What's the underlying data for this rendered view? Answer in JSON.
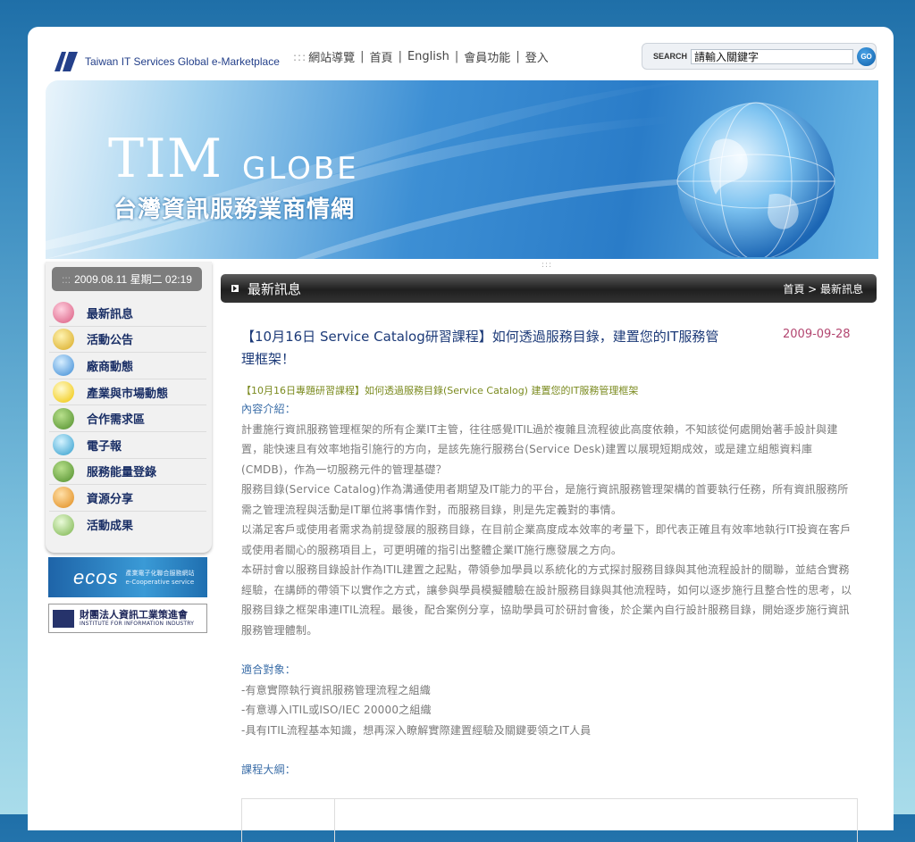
{
  "header": {
    "logo_text": "Taiwan IT Services Global e-Marketplace",
    "nav_lead": ":::",
    "nav": [
      "網站導覽",
      "首頁",
      "English",
      "會員功能",
      "登入"
    ],
    "search_label": "SEARCH",
    "search_placeholder": "請輸入關鍵字",
    "search_button": "GO"
  },
  "banner": {
    "title_main": "TIM",
    "title_globe": "GLOBE",
    "subtitle": "台灣資訊服務業商情網"
  },
  "sidebar": {
    "date_dots": ":::",
    "datetime": "2009.08.11 星期二 02:19",
    "menu": [
      {
        "label": "最新訊息",
        "icon": "pencil-icon"
      },
      {
        "label": "活動公告",
        "icon": "announcement-icon"
      },
      {
        "label": "廠商動態",
        "icon": "company-icon"
      },
      {
        "label": "產業與市場動態",
        "icon": "lightbulb-icon"
      },
      {
        "label": "合作需求區",
        "icon": "board-icon"
      },
      {
        "label": "電子報",
        "icon": "newsletter-icon"
      },
      {
        "label": "服務能量登錄",
        "icon": "register-icon"
      },
      {
        "label": "資源分享",
        "icon": "share-icon"
      },
      {
        "label": "活動成果",
        "icon": "magnifier-icon"
      }
    ],
    "ecos_big": "ecos",
    "ecos_small_cn": "產業電子化聯合服務網站",
    "ecos_small_en": "e-Cooperative service",
    "iii_cn": "財團法人資訊工業策進會",
    "iii_en": "INSTITUTE FOR INFORMATION INDUSTRY"
  },
  "main": {
    "section_title": "最新訊息",
    "breadcrumb": "首頁 > 最新訊息",
    "headline": "【10月16日 Service Catalog研習課程】如何透過服務目錄，建置您的IT服務管理框架！",
    "date": "2009-09-28",
    "subhead": "【10月16日專題研習課程】如何透過服務目錄(Service Catalog)  建置您的IT服務管理框架",
    "intro_label": "內容介紹：",
    "paragraphs": [
      "計畫施行資訊服務管理框架的所有企業IT主管，往往感覺ITIL過於複雜且流程彼此高度依賴，不知該從何處開始著手設計與建置，能快速且有效率地指引施行的方向，是該先施行服務台(Service Desk)建置以展現短期成效，或是建立組態資料庫(CMDB)，作為一切服務元件的管理基礎？",
      "服務目錄(Service Catalog)作為溝通使用者期望及IT能力的平台，是施行資訊服務管理架構的首要執行任務，所有資訊服務所需之管理流程與活動是IT單位將事情作對，而服務目錄，則是先定義對的事情。",
      "以滿足客戶或使用者需求為前提發展的服務目錄，在目前企業高度成本效率的考量下，即代表正確且有效率地執行IT投資在客戶或使用者關心的服務項目上，可更明確的指引出整體企業IT施行應發展之方向。",
      "本研討會以服務目錄設計作為ITIL建置之起點，帶領參加學員以系統化的方式探討服務目錄與其他流程設計的關聯，並結合實務經驗，在講師的帶領下以實作之方式，讓參與學員模擬體驗在設計服務目錄與其他流程時，如何以逐步施行且整合性的思考，以服務目錄之框架串連ITIL流程。最後，配合案例分享，協助學員可於研討會後，於企業內自行設計服務目錄，開始逐步施行資訊服務管理體制。"
    ],
    "audience_label": "適合對象：",
    "audience": [
      "-有意實際執行資訊服務管理流程之組織",
      "-有意導入ITIL或ISO/IEC 20000之組織",
      "-具有ITIL流程基本知識，想再深入瞭解實際建置經驗及關鍵要領之IT人員"
    ],
    "outline_label": "課程大綱："
  },
  "colors": {
    "headline": "#1c3a78",
    "date": "#b34670",
    "subhead": "#7a8a1e",
    "body": "#7a7a7a",
    "menu_text": "#1a2f66"
  }
}
